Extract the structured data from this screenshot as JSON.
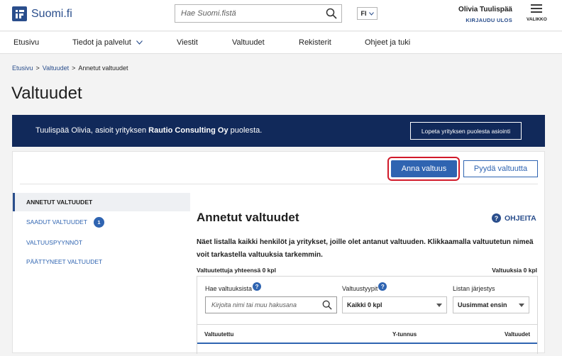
{
  "header": {
    "logo_text": "Suomi.fi",
    "search_placeholder": "Hae Suomi.fistä",
    "language": "FI",
    "user_name": "Olivia Tuulispää",
    "logout_label": "KIRJAUDU ULOS",
    "menu_label": "VALIKKO"
  },
  "nav": {
    "items": [
      {
        "label": "Etusivu"
      },
      {
        "label": "Tiedot ja palvelut"
      },
      {
        "label": "Viestit"
      },
      {
        "label": "Valtuudet"
      },
      {
        "label": "Rekisterit"
      },
      {
        "label": "Ohjeet ja tuki"
      }
    ]
  },
  "breadcrumb": {
    "items": [
      "Etusivu",
      "Valtuudet",
      "Annetut valtuudet"
    ],
    "separator": ">"
  },
  "page_title": "Valtuudet",
  "banner": {
    "text_prefix": "Tuulispää Olivia, asioit yrityksen ",
    "company": "Rautio Consulting Oy",
    "text_suffix": " puolesta.",
    "button_label": "Lopeta yrityksen puolesta asiointi"
  },
  "actions": {
    "give_label": "Anna valtuus",
    "request_label": "Pyydä valtuutta",
    "highlight_color": "#d11a2a"
  },
  "sidebar": {
    "items": [
      {
        "label": "ANNETUT VALTUUDET",
        "active": true
      },
      {
        "label": "SAADUT VALTUUDET",
        "badge": "1"
      },
      {
        "label": "VALTUUSPYYNNÖT"
      },
      {
        "label": "PÄÄTTYNEET VALTUUDET"
      }
    ]
  },
  "content": {
    "title": "Annetut valtuudet",
    "help_label": "OHJEITA",
    "description": "Näet listalla kaikki henkilöt ja yritykset, joille olet antanut valtuuden. Klikkaamalla valtuutetun nimeä voit tarkastella valtuuksia tarkemmin.",
    "total_left": "Valtuutettuja yhteensä 0 kpl",
    "total_right": "Valtuuksia 0 kpl",
    "filters": {
      "search_label": "Hae valtuuksista",
      "search_placeholder": "Kirjoita nimi tai muu hakusana",
      "type_label": "Valtuustyypit",
      "type_value": "Kaikki 0 kpl",
      "order_label": "Listan järjestys",
      "order_value": "Uusimmat ensin"
    },
    "table_headers": [
      "Valtuutettu",
      "Y-tunnus",
      "Valtuudet"
    ]
  },
  "colors": {
    "brand": "#2a4e8c",
    "banner_bg": "#11295a",
    "primary_button": "#2f64b1"
  }
}
